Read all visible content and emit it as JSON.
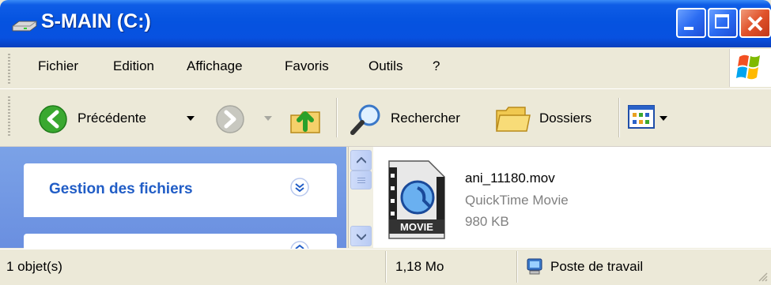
{
  "window": {
    "title": "S-MAIN (C:)"
  },
  "menu": {
    "items": [
      "Fichier",
      "Edition",
      "Affichage",
      "Favoris",
      "Outils",
      "?"
    ]
  },
  "toolbar": {
    "back_label": "Précédente",
    "search_label": "Rechercher",
    "folders_label": "Dossiers"
  },
  "tasks": {
    "file_management_title": "Gestion des fichiers"
  },
  "file": {
    "name": "ani_11180.mov",
    "type": "QuickTime Movie",
    "size": "980 KB",
    "icon_badge": "MOVIE"
  },
  "status": {
    "count": "1 objet(s)",
    "size": "1,18 Mo",
    "location": "Poste de travail"
  },
  "colors": {
    "titlebar": "#0553e0",
    "task_pane": "#7ba2e7",
    "task_title": "#215dc6",
    "close_button": "#e0522a"
  }
}
